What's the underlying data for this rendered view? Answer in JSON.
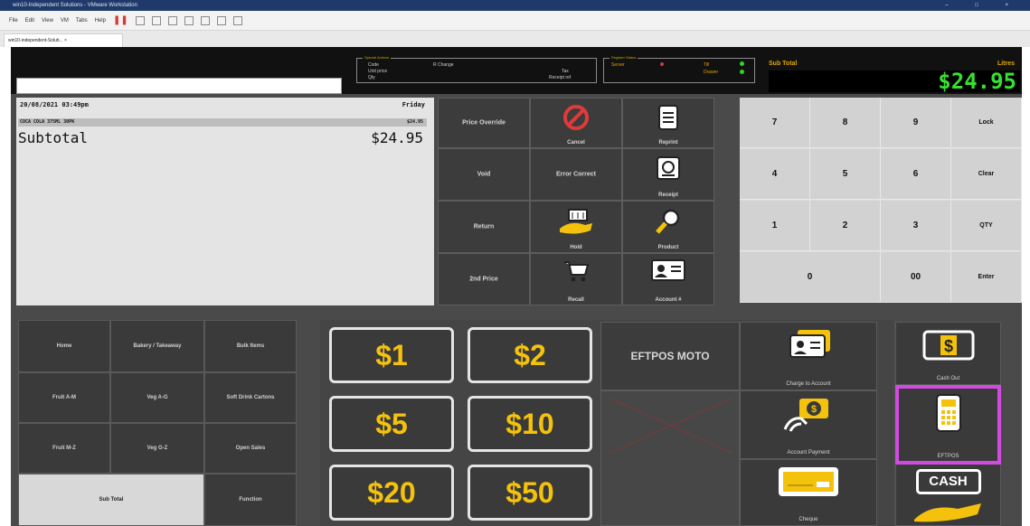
{
  "host": {
    "window_title": "win10-Independent Solutions - VMware Workstation",
    "window_controls": "– □ ×",
    "menu": [
      "File",
      "Edit",
      "View",
      "VM",
      "Tabs",
      "Help"
    ],
    "tab_label": "win10-independent-Soluti... ×"
  },
  "pos": {
    "info_panel_1": {
      "title": "Special Actions",
      "lines": [
        "Code",
        "R Change",
        "Unit price",
        "Tax",
        "Qty",
        "Receipt ref"
      ]
    },
    "info_panel_2": {
      "title": "Register Status",
      "lines": [
        "Server",
        "Till",
        "Drawer"
      ]
    },
    "subtotal_label": "Sub Total",
    "litres_label": "Litres",
    "subtotal_value": "$24.95",
    "receipt": {
      "datetime": "20/08/2021 03:49pm",
      "day": "Friday",
      "items": [
        {
          "name": "COCA COLA 375ML 30PK",
          "price": "$24.95"
        }
      ],
      "subtotal_label": "Subtotal",
      "subtotal_value": "$24.95"
    },
    "function_buttons": {
      "price_override": "Price Override",
      "cancel": "Cancel",
      "reprint": "Reprint",
      "void": "Void",
      "error_correct": "Error Correct",
      "receipt": "Receipt",
      "return": "Return",
      "hold": "Hold",
      "product": "Product",
      "second_price": "2nd Price",
      "recall": "Recall",
      "account_no": "Account #"
    },
    "keypad": {
      "row1": [
        "7",
        "8",
        "9",
        "Lock"
      ],
      "row2": [
        "4",
        "5",
        "6",
        "Clear"
      ],
      "row3": [
        "1",
        "2",
        "3",
        "QTY"
      ],
      "row4": [
        "0",
        "00",
        "Enter"
      ]
    },
    "departments": {
      "home": "Home",
      "bakery": "Bakery / Takeaway",
      "bulk": "Bulk Items",
      "fruit_am": "Fruit A-M",
      "veg_ag": "Veg A-G",
      "soft_drink": "Soft Drink Cartons",
      "fruit_mz": "Fruit M-Z",
      "veg_gz": "Veg G-Z",
      "open_sales": "Open Sales",
      "sub_total": "Sub Total",
      "function": "Function"
    },
    "tender": {
      "d1": "$1",
      "d2": "$2",
      "eftpos_moto": "EFTPOS MOTO",
      "d5": "$5",
      "d10": "$10",
      "d20": "$20",
      "d50": "$50",
      "charge_to_account": "Charge to Account",
      "account_payment": "Account Payment",
      "cheque": "Cheque",
      "cash_out": "Cash Out",
      "eftpos": "EFTPOS",
      "cash": "CASH",
      "dollar_sign": "$"
    }
  },
  "colors": {
    "subtotal_green": "#37e02f",
    "money_yellow": "#f4c20d",
    "highlight": "#d24be1",
    "cancel_red": "#e03a3a"
  }
}
